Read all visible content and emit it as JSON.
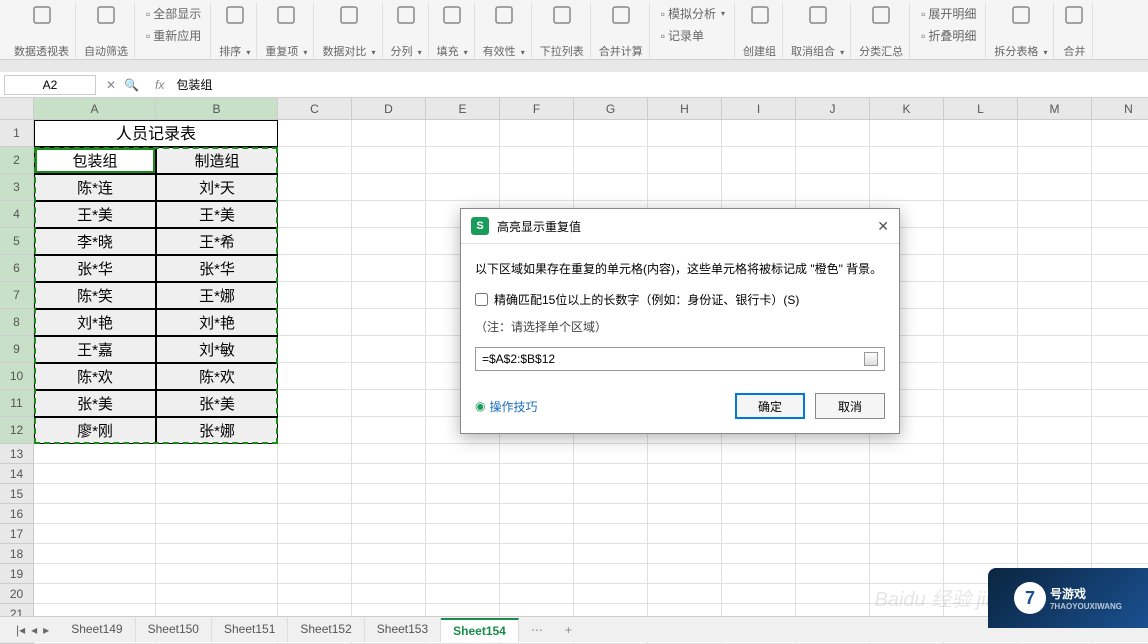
{
  "ribbon": [
    {
      "label": "数据透视表",
      "type": "big"
    },
    {
      "label": "自动筛选",
      "type": "big"
    },
    {
      "stack": [
        {
          "label": "全部显示"
        },
        {
          "label": "重新应用"
        }
      ]
    },
    {
      "label": "排序",
      "type": "big",
      "arrow": true
    },
    {
      "label": "重复项",
      "type": "big",
      "arrow": true
    },
    {
      "label": "数据对比",
      "type": "big",
      "arrow": true
    },
    {
      "label": "分列",
      "type": "big",
      "arrow": true
    },
    {
      "label": "填充",
      "type": "big",
      "arrow": true
    },
    {
      "label": "有效性",
      "type": "big",
      "arrow": true
    },
    {
      "label": "下拉列表",
      "type": "big"
    },
    {
      "label": "合并计算",
      "type": "big"
    },
    {
      "stack": [
        {
          "label": "模拟分析",
          "arrow": true
        },
        {
          "label": "记录单"
        }
      ]
    },
    {
      "label": "创建组",
      "type": "big"
    },
    {
      "label": "取消组合",
      "type": "big",
      "arrow": true
    },
    {
      "label": "分类汇总",
      "type": "big"
    },
    {
      "stack": [
        {
          "label": "展开明细"
        },
        {
          "label": "折叠明细"
        }
      ]
    },
    {
      "label": "拆分表格",
      "type": "big",
      "arrow": true
    },
    {
      "label": "合并",
      "type": "big"
    }
  ],
  "formula_bar": {
    "cell_ref": "A2",
    "formula": "包装组"
  },
  "columns": [
    "A",
    "B",
    "C",
    "D",
    "E",
    "F",
    "G",
    "H",
    "I",
    "J",
    "K",
    "L",
    "M",
    "N"
  ],
  "col_widths": {
    "default": 74,
    "A": 122,
    "B": 122
  },
  "rows": 22,
  "table": {
    "title": "人员记录表",
    "headers": [
      "包装组",
      "制造组"
    ],
    "data": [
      [
        "陈*连",
        "刘*天"
      ],
      [
        "王*美",
        "王*美"
      ],
      [
        "李*晓",
        "王*希"
      ],
      [
        "张*华",
        "张*华"
      ],
      [
        "陈*笑",
        "王*娜"
      ],
      [
        "刘*艳",
        "刘*艳"
      ],
      [
        "王*嘉",
        "刘*敏"
      ],
      [
        "陈*欢",
        "陈*欢"
      ],
      [
        "张*美",
        "张*美"
      ],
      [
        "廖*刚",
        "张*娜"
      ]
    ]
  },
  "selection": {
    "range": "A2:B12",
    "active": "A2"
  },
  "dialog": {
    "title": "高亮显示重复值",
    "desc": "以下区域如果存在重复的单元格(内容)，这些单元格将被标记成 \"橙色\" 背景。",
    "checkbox": "精确匹配15位以上的长数字（例如：身份证、银行卡）(S)",
    "note": "（注：请选择单个区域）",
    "range": "=$A$2:$B$12",
    "tip": "操作技巧",
    "ok": "确定",
    "cancel": "取消"
  },
  "tabs": [
    "Sheet149",
    "Sheet150",
    "Sheet151",
    "Sheet152",
    "Sheet153",
    "Sheet154"
  ],
  "active_tab": "Sheet154",
  "watermark": "Baidu 经验 jingyan.baidu.com",
  "game_logo": {
    "num": "7",
    "text": "号游戏",
    "sub": "7HAOYOUXIWANG"
  }
}
